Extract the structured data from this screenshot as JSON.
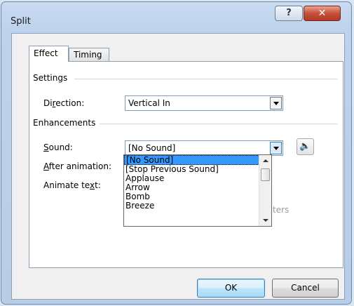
{
  "window": {
    "title": "Split"
  },
  "titlebar": {
    "help_glyph": "?",
    "close_glyph": "✕"
  },
  "tabs": [
    {
      "label": "Effect"
    },
    {
      "label": "Timing"
    }
  ],
  "settings": {
    "heading": "Settings",
    "direction_label": "Direction:",
    "direction_value": "Vertical In"
  },
  "enhancements": {
    "heading": "Enhancements",
    "sound_label": "Sound:",
    "sound_value": "[No Sound]",
    "after_animation_label": "After animation:",
    "animate_text_label": "Animate text:"
  },
  "sound_options": [
    "[No Sound]",
    "[Stop Previous Sound]",
    "Applause",
    "Arrow",
    "Bomb",
    "Breeze"
  ],
  "hidden_text_fragment": "ters",
  "buttons": {
    "ok": "OK",
    "cancel": "Cancel"
  }
}
